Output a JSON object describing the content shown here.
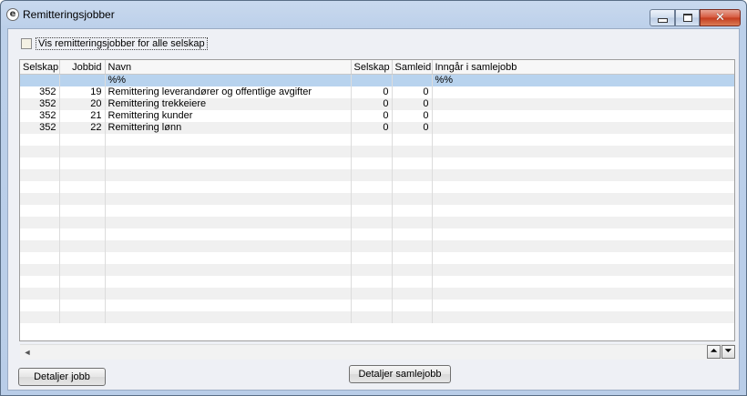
{
  "window": {
    "title": "Remitteringsjobber",
    "close_glyph": "✕"
  },
  "options": {
    "show_all_label": "Vis remitteringsjobber for alle selskap"
  },
  "grid": {
    "columns": [
      "Selskap",
      "Jobbid",
      "Navn",
      "Selskap",
      "Samleid",
      "Inngår i samlejobb"
    ],
    "filter_row": [
      "",
      "",
      "%%",
      "",
      "",
      "%%"
    ],
    "rows": [
      [
        "352",
        "19",
        "Remittering leverandører og offentlige avgifter",
        "0",
        "0",
        ""
      ],
      [
        "352",
        "20",
        "Remittering trekkeiere",
        "0",
        "0",
        ""
      ],
      [
        "352",
        "21",
        "Remittering kunder",
        "0",
        "0",
        ""
      ],
      [
        "352",
        "22",
        "Remittering lønn",
        "0",
        "0",
        ""
      ]
    ]
  },
  "scroll": {
    "left_arrow": "◄",
    "first_glyph": "⏶",
    "last_glyph": "⏷"
  },
  "buttons": {
    "detaljer_jobb": "Detaljer jobb",
    "detaljer_samlejobb": "Detaljer samlejobb"
  },
  "icons": {
    "app": "e-logo-icon"
  },
  "colors": {
    "filter_row": "#b8d3ee",
    "close_button": "#c43b1e",
    "titlebar": "#c9d9ee"
  }
}
